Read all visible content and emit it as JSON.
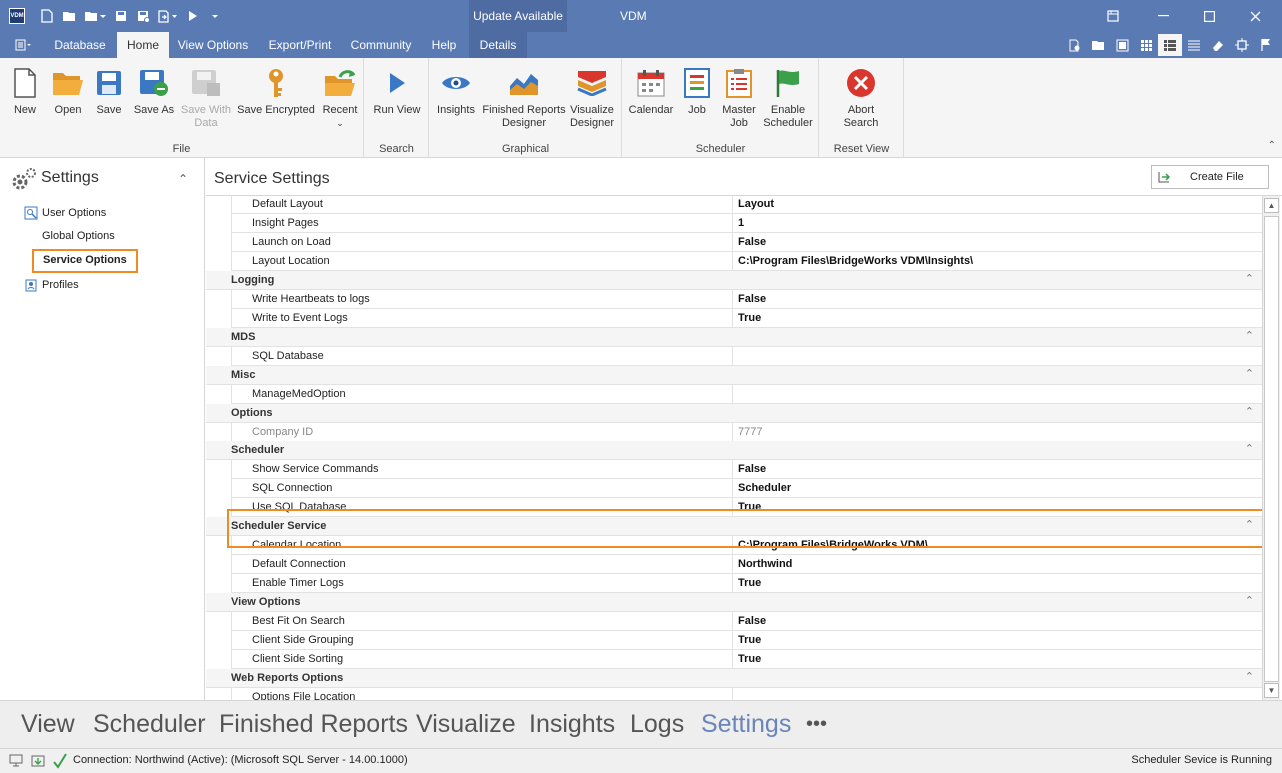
{
  "titlebar": {
    "logo": "VDM",
    "update": "Update Available",
    "title": "VDM",
    "quick_access_icons": [
      "new-icon",
      "open-icon",
      "open-dropdown-icon",
      "save-icon",
      "save-as-icon",
      "export-icon",
      "run-icon",
      "customize-icon"
    ]
  },
  "tabs": {
    "app_menu": "app-menu-icon",
    "items": [
      "Database",
      "Home",
      "View Options",
      "Export/Print",
      "Community",
      "Help",
      "Details"
    ],
    "active": "Home"
  },
  "ribbon": {
    "groups": {
      "file": "File",
      "search": "Search",
      "graphical": "Graphical",
      "scheduler": "Scheduler",
      "reset_view": "Reset View"
    },
    "buttons": {
      "new": "New",
      "open": "Open",
      "save": "Save",
      "save_as": "Save As",
      "save_with_data_1": "Save With",
      "save_with_data_2": "Data",
      "save_encrypted": "Save Encrypted",
      "recent": "Recent",
      "run_view": "Run View",
      "insights": "Insights",
      "finished_reports_1": "Finished Reports",
      "finished_reports_2": "Designer",
      "visualize_1": "Visualize",
      "visualize_2": "Designer",
      "calendar": "Calendar",
      "job": "Job",
      "master_job_1": "Master",
      "master_job_2": "Job",
      "enable_scheduler_1": "Enable",
      "enable_scheduler_2": "Scheduler",
      "abort_search_1": "Abort",
      "abort_search_2": "Search"
    }
  },
  "left_panel": {
    "title": "Settings",
    "items": {
      "user_options": "User Options",
      "global_options": "Global Options",
      "service_options": "Service Options",
      "profiles": "Profiles"
    }
  },
  "main": {
    "title": "Service Settings",
    "create_file": "Create File",
    "rows": {
      "default_layout": {
        "name": "Default Layout",
        "value": "Layout"
      },
      "insight_pages": {
        "name": "Insight Pages",
        "value": "1"
      },
      "launch_on_load": {
        "name": "Launch on Load",
        "value": "False"
      },
      "layout_location": {
        "name": "Layout Location",
        "value": "C:\\Program Files\\BridgeWorks VDM\\Insights\\"
      },
      "logging": "Logging",
      "write_heartbeats": {
        "name": "Write Heartbeats to logs",
        "value": "False"
      },
      "write_event_logs": {
        "name": "Write to Event Logs",
        "value": "True"
      },
      "mds": "MDS",
      "sql_database": {
        "name": "SQL Database",
        "value": ""
      },
      "misc": "Misc",
      "manage_med_option": {
        "name": "ManageMedOption",
        "value": ""
      },
      "options": "Options",
      "company_id": {
        "name": "Company ID",
        "value": "7777"
      },
      "scheduler": "Scheduler",
      "show_service_commands": {
        "name": "Show Service Commands",
        "value": "False"
      },
      "sql_connection": {
        "name": "SQL Connection",
        "value": "Scheduler"
      },
      "use_sql_database": {
        "name": "Use SQL Database",
        "value": "True"
      },
      "scheduler_service": "Scheduler Service",
      "calendar_location": {
        "name": "Calendar Location",
        "value": "C:\\Program Files\\BridgeWorks VDM\\"
      },
      "default_connection": {
        "name": "Default Connection",
        "value": "Northwind"
      },
      "enable_timer_logs": {
        "name": "Enable Timer Logs",
        "value": "True"
      },
      "view_options": "View Options",
      "best_fit_on_search": {
        "name": "Best Fit On Search",
        "value": "False"
      },
      "client_side_grouping": {
        "name": "Client Side Grouping",
        "value": "True"
      },
      "client_side_sorting": {
        "name": "Client Side Sorting",
        "value": "True"
      },
      "web_reports_options": "Web Reports Options",
      "options_file_location": {
        "name": "Options File Location",
        "value": ""
      }
    }
  },
  "bottom_nav": {
    "view": "View",
    "scheduler": "Scheduler",
    "finished_reports": "Finished Reports",
    "visualize": "Visualize",
    "insights": "Insights",
    "logs": "Logs",
    "settings": "Settings",
    "more": "•••"
  },
  "status": {
    "connection": "Connection: Northwind (Active): (Microsoft SQL Server - 14.00.1000)",
    "service": "Scheduler Sevice is Running"
  },
  "colors": {
    "titlebar": "#5a7ab3",
    "highlight": "#f08a24",
    "active_nav": "#6a85b8"
  }
}
